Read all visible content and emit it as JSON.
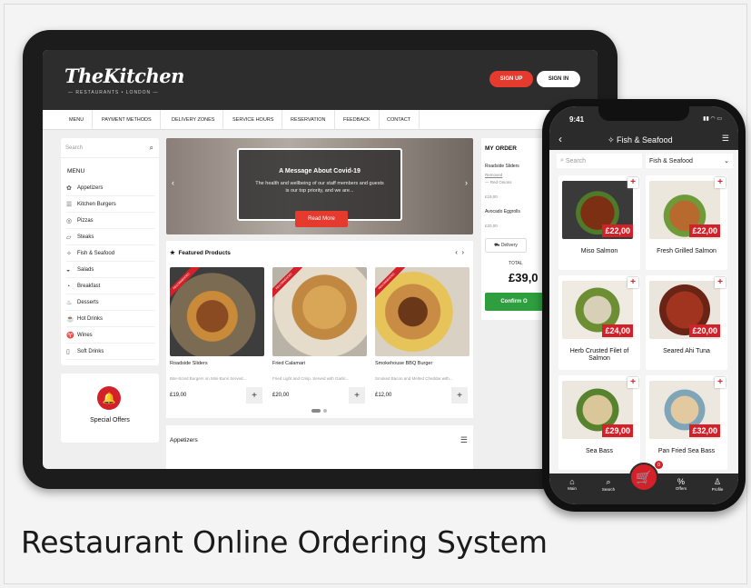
{
  "caption": "Restaurant Online Ordering System",
  "website": {
    "logo": "TheKitchen",
    "logo_sub": "— RESTAURANTS • LONDON —",
    "sign_up": "SIGN UP",
    "sign_in": "SIGN IN",
    "nav": [
      "MENU",
      "PAYMENT METHODS",
      "DELIVERY ZONES",
      "SERVICE HOURS",
      "RESERVATION",
      "FEEDBACK",
      "CONTACT"
    ],
    "search_placeholder": "Search",
    "menu_heading": "MENU",
    "menu_items": [
      "Appetizers",
      "Kitchen Burgers",
      "Pizzas",
      "Steaks",
      "Fish & Seafood",
      "Salads",
      "Breakfast",
      "Desserts",
      "Hot Drinks",
      "Wines",
      "Soft Drinks"
    ],
    "special_offers": "Special Offers",
    "hero": {
      "title": "A Message About Covid-19",
      "body": "The health and wellbeing of our staff members and guests is our top priority, and we are...",
      "button": "Read More"
    },
    "featured_heading": "Featured Products",
    "badge": "RECOMMENDED",
    "products": [
      {
        "name": "Roadside Sliders",
        "desc": "Bite-Sized Burgers on Mini-Buns Served...",
        "price": "£19,00"
      },
      {
        "name": "Fried Calamari",
        "desc": "Fried Light and Crisp. Served with Garlic...",
        "price": "£20,00"
      },
      {
        "name": "Smokehouse BBQ Burger",
        "desc": "Smoked Bacon and Melted Cheddar with...",
        "price": "£12,00"
      }
    ],
    "appetizers_heading": "Appetizers",
    "order": {
      "heading": "MY ORDER",
      "item1": "Roadside Sliders",
      "removed": "Removed",
      "removed_item": "— Red Onions",
      "price1": "£19,00",
      "item2": "Avocado Eggrolls",
      "price2": "£20,00",
      "delivery": "Delivery",
      "total_label": "TOTAL",
      "total": "£39,0",
      "confirm": "Confirm O"
    }
  },
  "phone": {
    "time": "9:41",
    "title": "Fish & Seafood",
    "search_placeholder": "Search",
    "category": "Fish & Seafood",
    "items": [
      {
        "name": "Miso Salmon",
        "price": "£22,00"
      },
      {
        "name": "Fresh Grilled Salmon",
        "price": "£22,00"
      },
      {
        "name": "Herb Crusted Filet of Salmon",
        "price": "£24,00"
      },
      {
        "name": "Seared Ahi Tuna",
        "price": "£20,00"
      },
      {
        "name": "Sea Bass",
        "price": "£29,00"
      },
      {
        "name": "Pan Fried Sea Bass",
        "price": "£32,00"
      }
    ],
    "tabs": [
      "Main",
      "Search",
      "Offers",
      "Profile"
    ],
    "cart_count": "0"
  },
  "colors": {
    "accent": "#d32029",
    "dark": "#2b2b2b",
    "green": "#2e9e3e"
  }
}
